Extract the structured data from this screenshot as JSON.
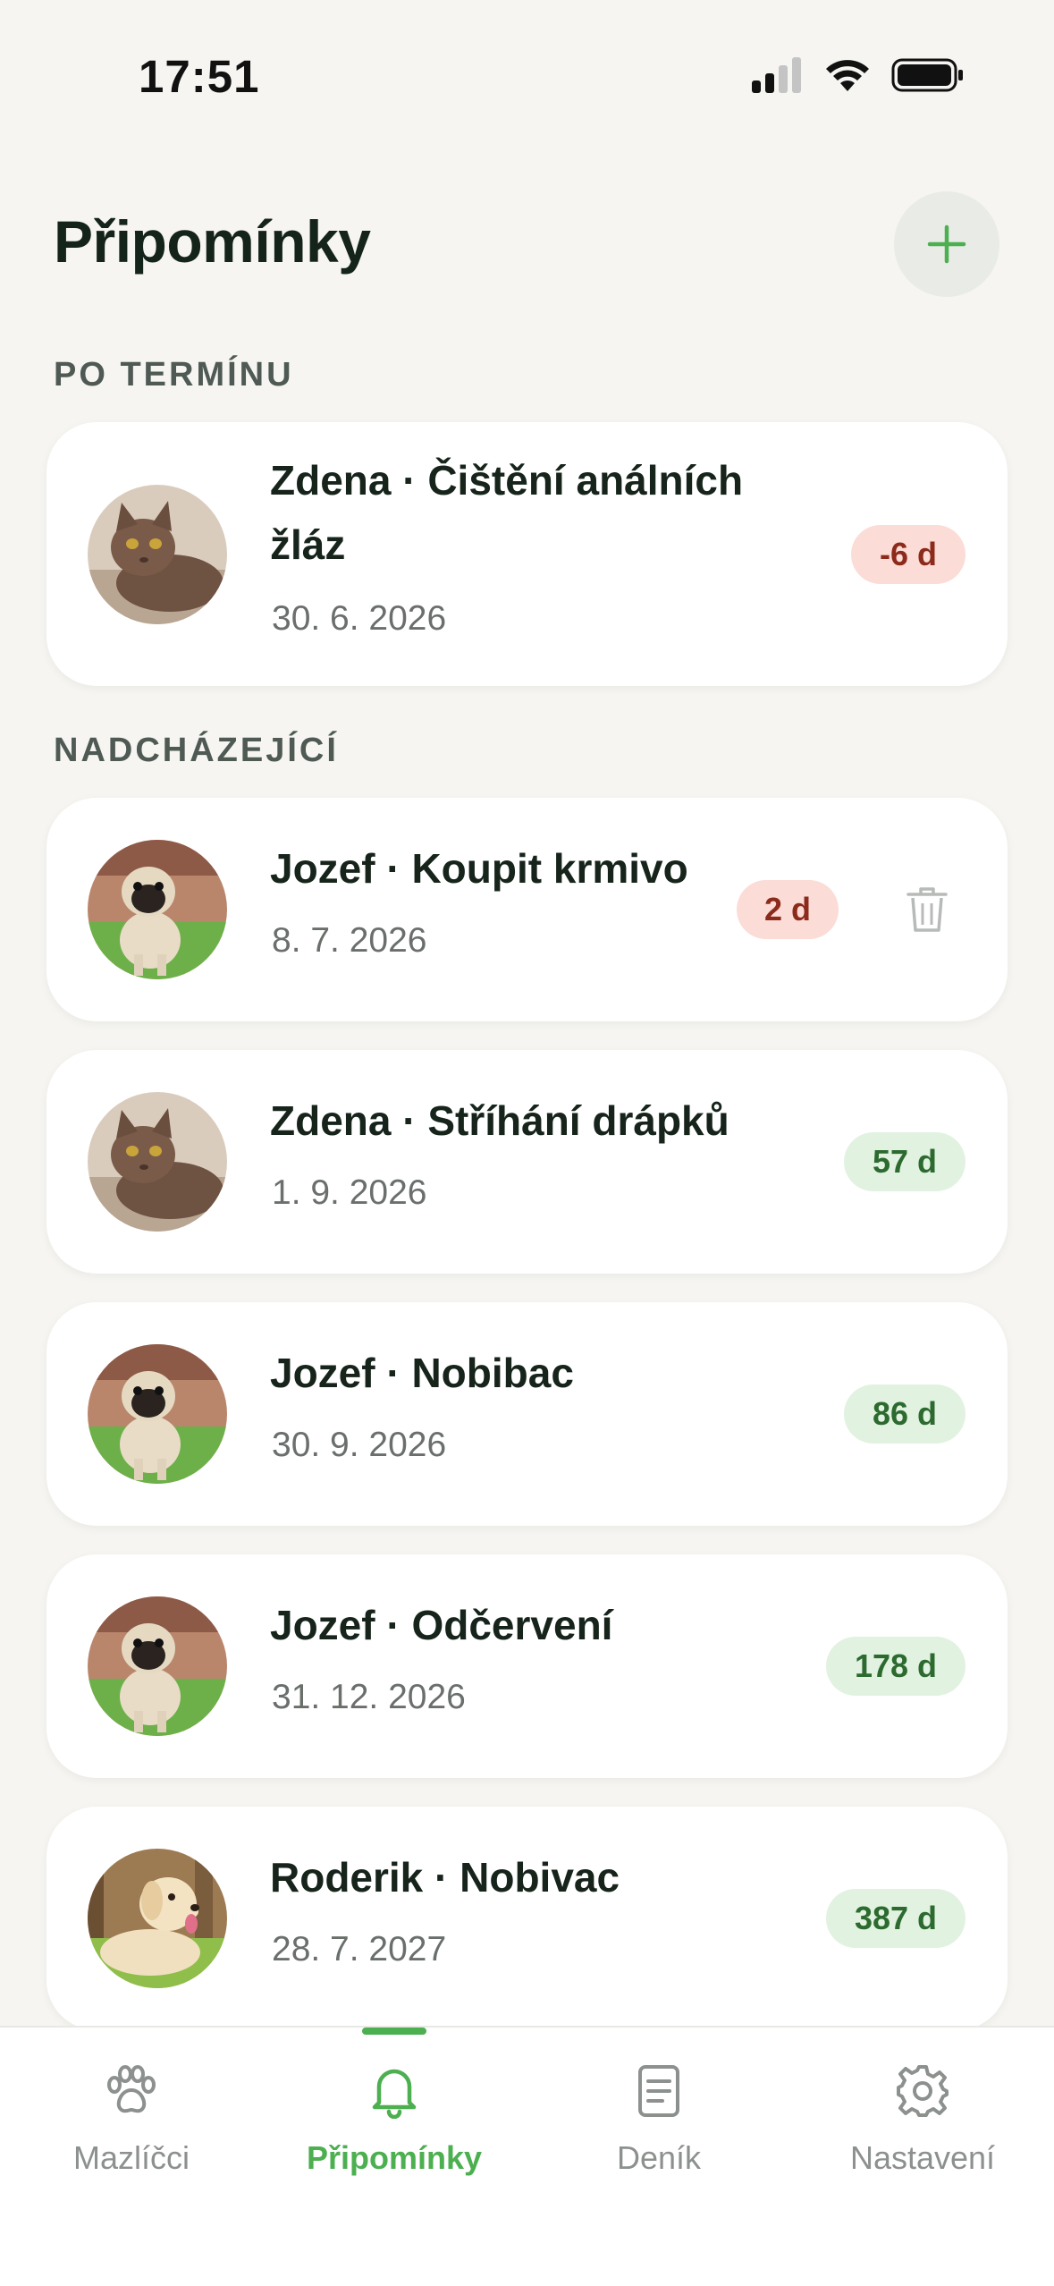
{
  "status": {
    "time": "17:51"
  },
  "header": {
    "title": "Připomínky",
    "add_icon": "plus-icon"
  },
  "sections": {
    "overdue_label": "PO TERMÍNU",
    "upcoming_label": "NADCHÁZEJÍCÍ"
  },
  "overdue": [
    {
      "title_line1": "Zdena · Čištění análních",
      "title_line2": "žláz",
      "date": "30. 6. 2026",
      "badge": "-6 d",
      "pet": "cat"
    }
  ],
  "upcoming": [
    {
      "title": "Jozef · Koupit krmivo",
      "date": "8. 7. 2026",
      "badge": "2 d",
      "pet": "pug"
    },
    {
      "title": "Zdena · Stříhání drápků",
      "date": "1. 9. 2026",
      "badge": "57 d",
      "pet": "cat"
    },
    {
      "title": "Jozef · Nobibac",
      "date": "30. 9. 2026",
      "badge": "86 d",
      "pet": "pug"
    },
    {
      "title": "Jozef · Odčervení",
      "date": "31. 12. 2026",
      "badge": "178 d",
      "pet": "pug"
    },
    {
      "title": "Roderik · Nobivac",
      "date": "28. 7. 2027",
      "badge": "387 d",
      "pet": "labrador"
    }
  ],
  "tabs": [
    {
      "label": "Mazlíčci",
      "icon": "paw-icon"
    },
    {
      "label": "Připomínky",
      "icon": "bell-icon",
      "active": true
    },
    {
      "label": "Deník",
      "icon": "journal-icon"
    },
    {
      "label": "Nastavení",
      "icon": "gear-icon"
    }
  ],
  "colors": {
    "accent": "#4caf50",
    "overdue_badge_bg": "#fbdcd6",
    "overdue_badge_text": "#8c2a1c",
    "ok_badge_bg": "#e2f2e1",
    "ok_badge_text": "#2c6a2f",
    "background": "#f6f5f1"
  }
}
